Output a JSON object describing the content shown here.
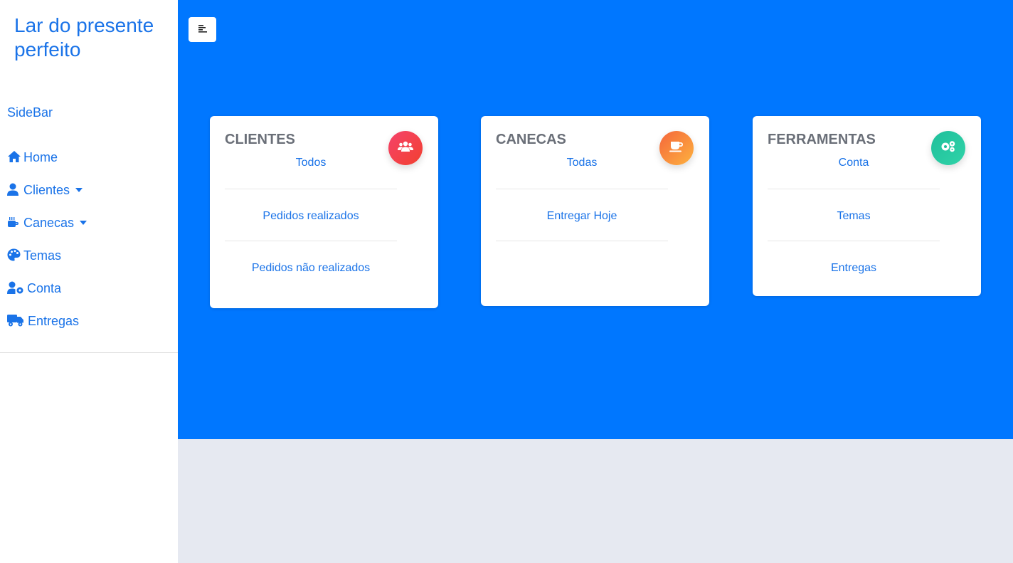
{
  "sidebar": {
    "brand": "Lar do presente perfeito",
    "heading": "SideBar",
    "items": [
      {
        "label": "Home",
        "icon": "home-icon",
        "dropdown": false
      },
      {
        "label": "Clientes",
        "icon": "user-icon",
        "dropdown": true
      },
      {
        "label": "Canecas",
        "icon": "mug-icon",
        "dropdown": true
      },
      {
        "label": "Temas",
        "icon": "palette-icon",
        "dropdown": false
      },
      {
        "label": "Conta",
        "icon": "user-cog-icon",
        "dropdown": false
      },
      {
        "label": "Entregas",
        "icon": "truck-icon",
        "dropdown": false
      }
    ]
  },
  "toolbar": {
    "toggle_icon": "align-left-icon"
  },
  "colors": {
    "primary": "#0077ff",
    "link": "#1a73e8",
    "page_bg": "#e6e9f1"
  },
  "cards": [
    {
      "title": "CLIENTES",
      "icon": "users-icon",
      "badge_colors": [
        "#f5436b",
        "#f2402f"
      ],
      "links": [
        "Todos",
        "Pedidos realizados",
        "Pedidos não realizados"
      ]
    },
    {
      "title": "CANECAS",
      "icon": "coffee-icon",
      "badge_colors": [
        "#f5663b",
        "#fdb23f"
      ],
      "links": [
        "Todas",
        "Entregar Hoje"
      ]
    },
    {
      "title": "FERRAMENTAS",
      "icon": "cogs-icon",
      "badge_colors": [
        "#1fbf9b",
        "#30d3a8"
      ],
      "links": [
        "Conta",
        "Temas",
        "Entregas"
      ]
    }
  ]
}
